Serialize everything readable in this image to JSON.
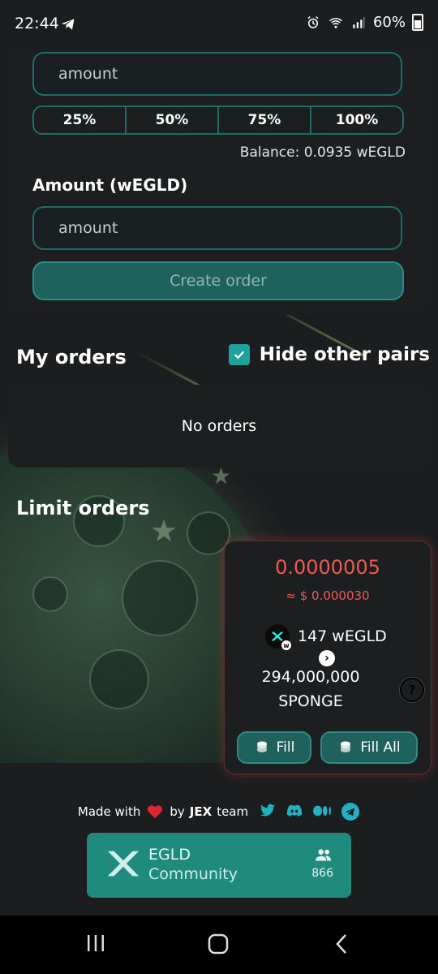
{
  "status_bar": {
    "time": "22:44",
    "battery": "60%",
    "icons": [
      "telegram-icon",
      "alarm-icon",
      "wifi-icon",
      "signal-icon",
      "battery-icon"
    ]
  },
  "order_form": {
    "price_placeholder": "amount",
    "percent_buttons": [
      "25%",
      "50%",
      "75%",
      "100%"
    ],
    "balance": "Balance: 0.0935 wEGLD",
    "amount_label": "Amount (wEGLD)",
    "amount_placeholder": "amount",
    "create_button": "Create order"
  },
  "my_orders": {
    "title": "My orders",
    "hide_other_pairs_label": "Hide other pairs",
    "hide_other_pairs_checked": true,
    "empty_text": "No orders"
  },
  "limit_orders": {
    "title": "Limit orders",
    "orders": [
      {
        "price": "0.0000005",
        "usd": "≈ $ 0.000030",
        "pay_amount": "147 wEGLD",
        "receive_amount": "294,000,000",
        "receive_token": "SPONGE",
        "help": "?",
        "fill_label": "Fill",
        "fill_all_label": "Fill All"
      }
    ]
  },
  "footer": {
    "made_with": "Made with",
    "by": "by",
    "team": "JEX",
    "team_suffix": "team",
    "social_icons": [
      "twitter-icon",
      "discord-icon",
      "medium-icon",
      "telegram-icon"
    ],
    "community_line1": "EGLD",
    "community_line2": "Community",
    "community_members": "866"
  },
  "colors": {
    "accent": "#1f615c",
    "border": "#1d6c68",
    "price_red": "#f05a4f",
    "community_bg": "#1f8a7e"
  }
}
